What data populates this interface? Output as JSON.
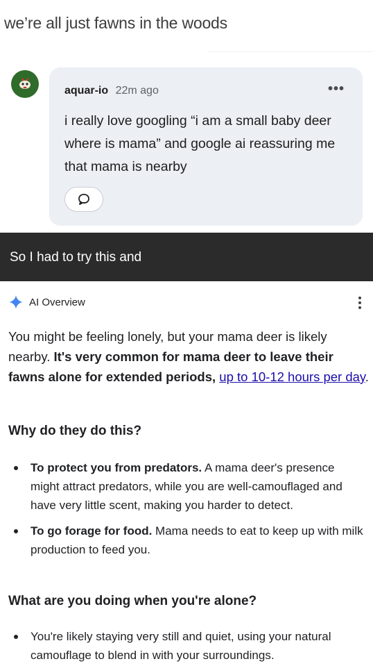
{
  "caption": "we’re all just fawns in the woods",
  "comment": {
    "username": "aquar-io",
    "time": "22m ago",
    "more": "•••",
    "text": "i really love googling “i am a small baby deer where is mama” and google ai reassuring me that mama is nearby"
  },
  "dark_bar": {
    "text": "So I had to try this and"
  },
  "ai_overview": {
    "label": "AI Overview",
    "intro_plain": "You might be feeling lonely, but your mama deer is likely nearby. ",
    "intro_bold": "It's very common for mama deer to leave their fawns alone for extended periods, ",
    "intro_link": "up to 10-12 hours per day",
    "intro_end": ".",
    "section1_title": "Why do they do this?",
    "section1_items": [
      {
        "bold": "To protect you from predators.",
        "text": " A mama deer's presence might attract predators, while you are well-camouflaged and have very little scent, making you harder to detect."
      },
      {
        "bold": "To go forage for food.",
        "text": " Mama needs to eat to keep up with milk production to feed you."
      }
    ],
    "section2_title": "What are you doing when you're alone?",
    "section2_items": [
      {
        "text": "You're likely staying very still and quiet, using your natural camouflage to blend in with your surroundings."
      }
    ]
  },
  "colors": {
    "link": "#1a0dab",
    "sparkle": "#4285f4",
    "card_bg": "#eceff4",
    "dark_bar": "#2b2b2b"
  },
  "icons": {
    "avatar": "avatar-icon",
    "reply": "comment-bubble-icon",
    "sparkle": "gemini-sparkle-icon",
    "menu": "kebab-menu-icon"
  }
}
